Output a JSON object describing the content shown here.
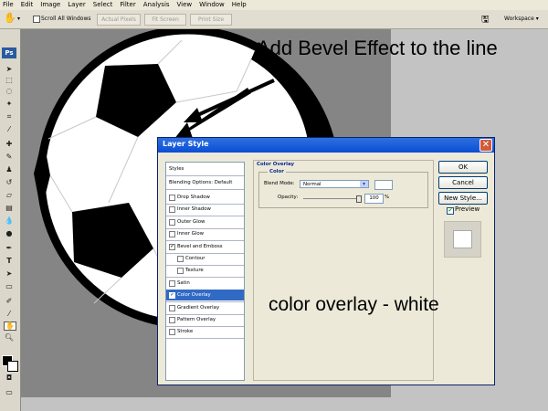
{
  "menu": [
    "File",
    "Edit",
    "Image",
    "Layer",
    "Select",
    "Filter",
    "Analysis",
    "View",
    "Window",
    "Help"
  ],
  "options_bar": {
    "scroll_all_label": "Scroll All Windows",
    "actual_pixels": "Actual Pixels",
    "fit_screen": "Fit Screen",
    "print_size": "Print Size",
    "workspace": "Workspace ▾"
  },
  "toolbar": {
    "logo": "Ps"
  },
  "annotations": {
    "top": "Add Bevel Effect to the line",
    "overlay_note": "color overlay - white"
  },
  "dialog": {
    "title": "Layer Style",
    "styles_header": "Styles",
    "blending_options": "Blending Options: Default",
    "items": [
      {
        "label": "Drop Shadow",
        "checked": false,
        "indent": false,
        "selected": false
      },
      {
        "label": "Inner Shadow",
        "checked": false,
        "indent": false,
        "selected": false
      },
      {
        "label": "Outer Glow",
        "checked": false,
        "indent": false,
        "selected": false
      },
      {
        "label": "Inner Glow",
        "checked": false,
        "indent": false,
        "selected": false
      },
      {
        "label": "Bevel and Emboss",
        "checked": true,
        "indent": false,
        "selected": false
      },
      {
        "label": "Contour",
        "checked": false,
        "indent": true,
        "selected": false
      },
      {
        "label": "Texture",
        "checked": false,
        "indent": true,
        "selected": false
      },
      {
        "label": "Satin",
        "checked": false,
        "indent": false,
        "selected": false
      },
      {
        "label": "Color Overlay",
        "checked": true,
        "indent": false,
        "selected": true
      },
      {
        "label": "Gradient Overlay",
        "checked": false,
        "indent": false,
        "selected": false
      },
      {
        "label": "Pattern Overlay",
        "checked": false,
        "indent": false,
        "selected": false
      },
      {
        "label": "Stroke",
        "checked": false,
        "indent": false,
        "selected": false
      }
    ],
    "panel": {
      "section_title": "Color Overlay",
      "group_title": "Color",
      "blend_mode_label": "Blend Mode:",
      "blend_mode_value": "Normal",
      "overlay_color": "#ffffff",
      "opacity_label": "Opacity:",
      "opacity_value": "100",
      "opacity_unit": "%",
      "opacity_fraction": 1.0
    },
    "buttons": {
      "ok": "OK",
      "cancel": "Cancel",
      "new_style": "New Style...",
      "preview": "Preview"
    }
  },
  "colors": {
    "dialog_title_bar": "#0a4ed4",
    "selected_item": "#316ac5",
    "document_bg": "#858585",
    "workspace_bg": "#c3c3c3"
  }
}
